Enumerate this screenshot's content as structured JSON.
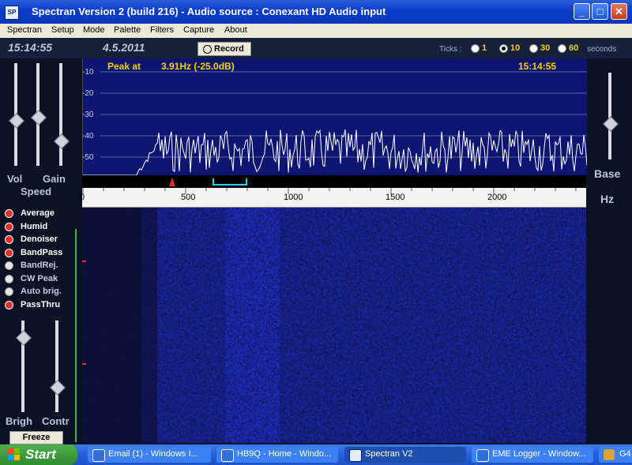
{
  "window": {
    "title": "Spectran Version 2 (build 216) - Audio source  :  Conexant HD Audio input",
    "controls": [
      "minimize",
      "maximize",
      "close"
    ]
  },
  "menu": [
    "Spectran",
    "Setup",
    "Mode",
    "Palette",
    "Filters",
    "Capture",
    "About"
  ],
  "status": {
    "time": "15:14:55",
    "date": "4.5.2011",
    "record_label": "Record",
    "ticks_label": "Ticks :",
    "tick_options": [
      "1",
      "10",
      "30",
      "60"
    ],
    "tick_selected": "10",
    "seconds_label": "seconds"
  },
  "sliders": {
    "vol_label": "Vol",
    "gain_label": "Gain",
    "speed_label": "Speed",
    "brigh_label": "Brigh",
    "contr_label": "Contr",
    "base_label": "Base",
    "hz_label": "Hz",
    "levels": {
      "vol": 0.55,
      "gain": 0.52,
      "speed": 0.75,
      "brigh": 0.18,
      "contr": 0.72,
      "base": 0.58
    }
  },
  "options": [
    {
      "label": "Average",
      "on": true
    },
    {
      "label": "Humid",
      "on": true
    },
    {
      "label": "Denoiser",
      "on": true
    },
    {
      "label": "BandPass",
      "on": true
    },
    {
      "label": "BandRej.",
      "on": false
    },
    {
      "label": "CW Peak",
      "on": false
    },
    {
      "label": "Auto brig.",
      "on": false
    },
    {
      "label": "PassThru",
      "on": true
    }
  ],
  "freeze_label": "Freeze",
  "spectrum": {
    "peak_label": "Peak at",
    "peak_value": "3.91Hz (-25.0dB)",
    "time": "15:14:55",
    "db_ticks": [
      "-10",
      "-20",
      "-30",
      "-40",
      "-50"
    ],
    "freq_ticks": [
      "0",
      "500",
      "1000",
      "1500",
      "2000"
    ]
  },
  "taskbar": {
    "start_label": "Start",
    "tasks": [
      {
        "label": "Email (1) - Windows I...",
        "active": false
      },
      {
        "label": "HB9Q - Home - Windo...",
        "active": false
      },
      {
        "label": "Spectran V2",
        "active": true
      },
      {
        "label": "EME Logger - Window...",
        "active": false
      },
      {
        "label": "G4",
        "active": false
      }
    ]
  },
  "colors": {
    "spectrum_bg": "#0e1570",
    "accent_text": "#f5d000",
    "trace": "#ffffff",
    "taskbar": "#245edb"
  }
}
